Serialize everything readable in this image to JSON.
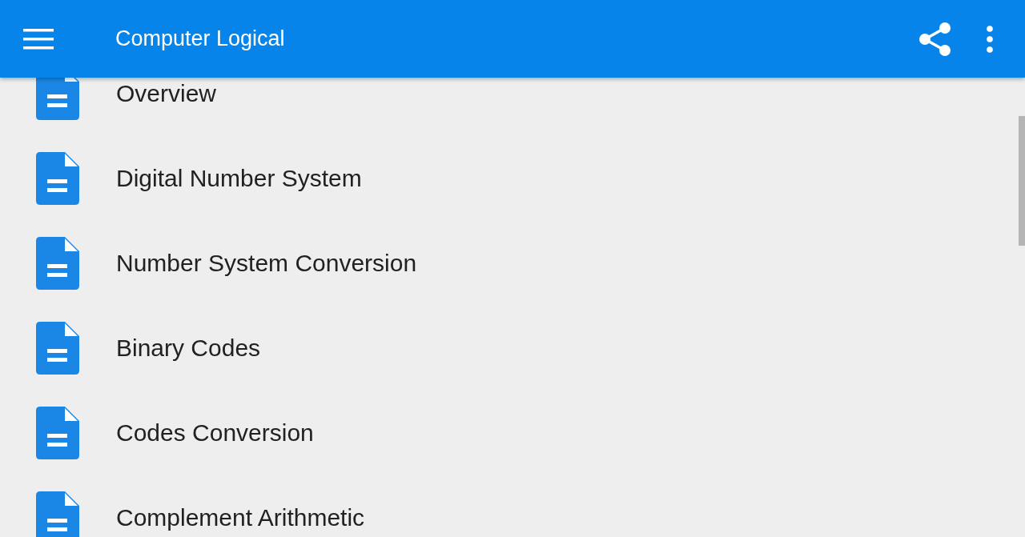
{
  "app_bar": {
    "title": "Computer Logical"
  },
  "items": [
    {
      "label": "Overview"
    },
    {
      "label": "Digital Number System"
    },
    {
      "label": "Number System Conversion"
    },
    {
      "label": "Binary Codes"
    },
    {
      "label": "Codes Conversion"
    },
    {
      "label": "Complement Arithmetic"
    }
  ]
}
